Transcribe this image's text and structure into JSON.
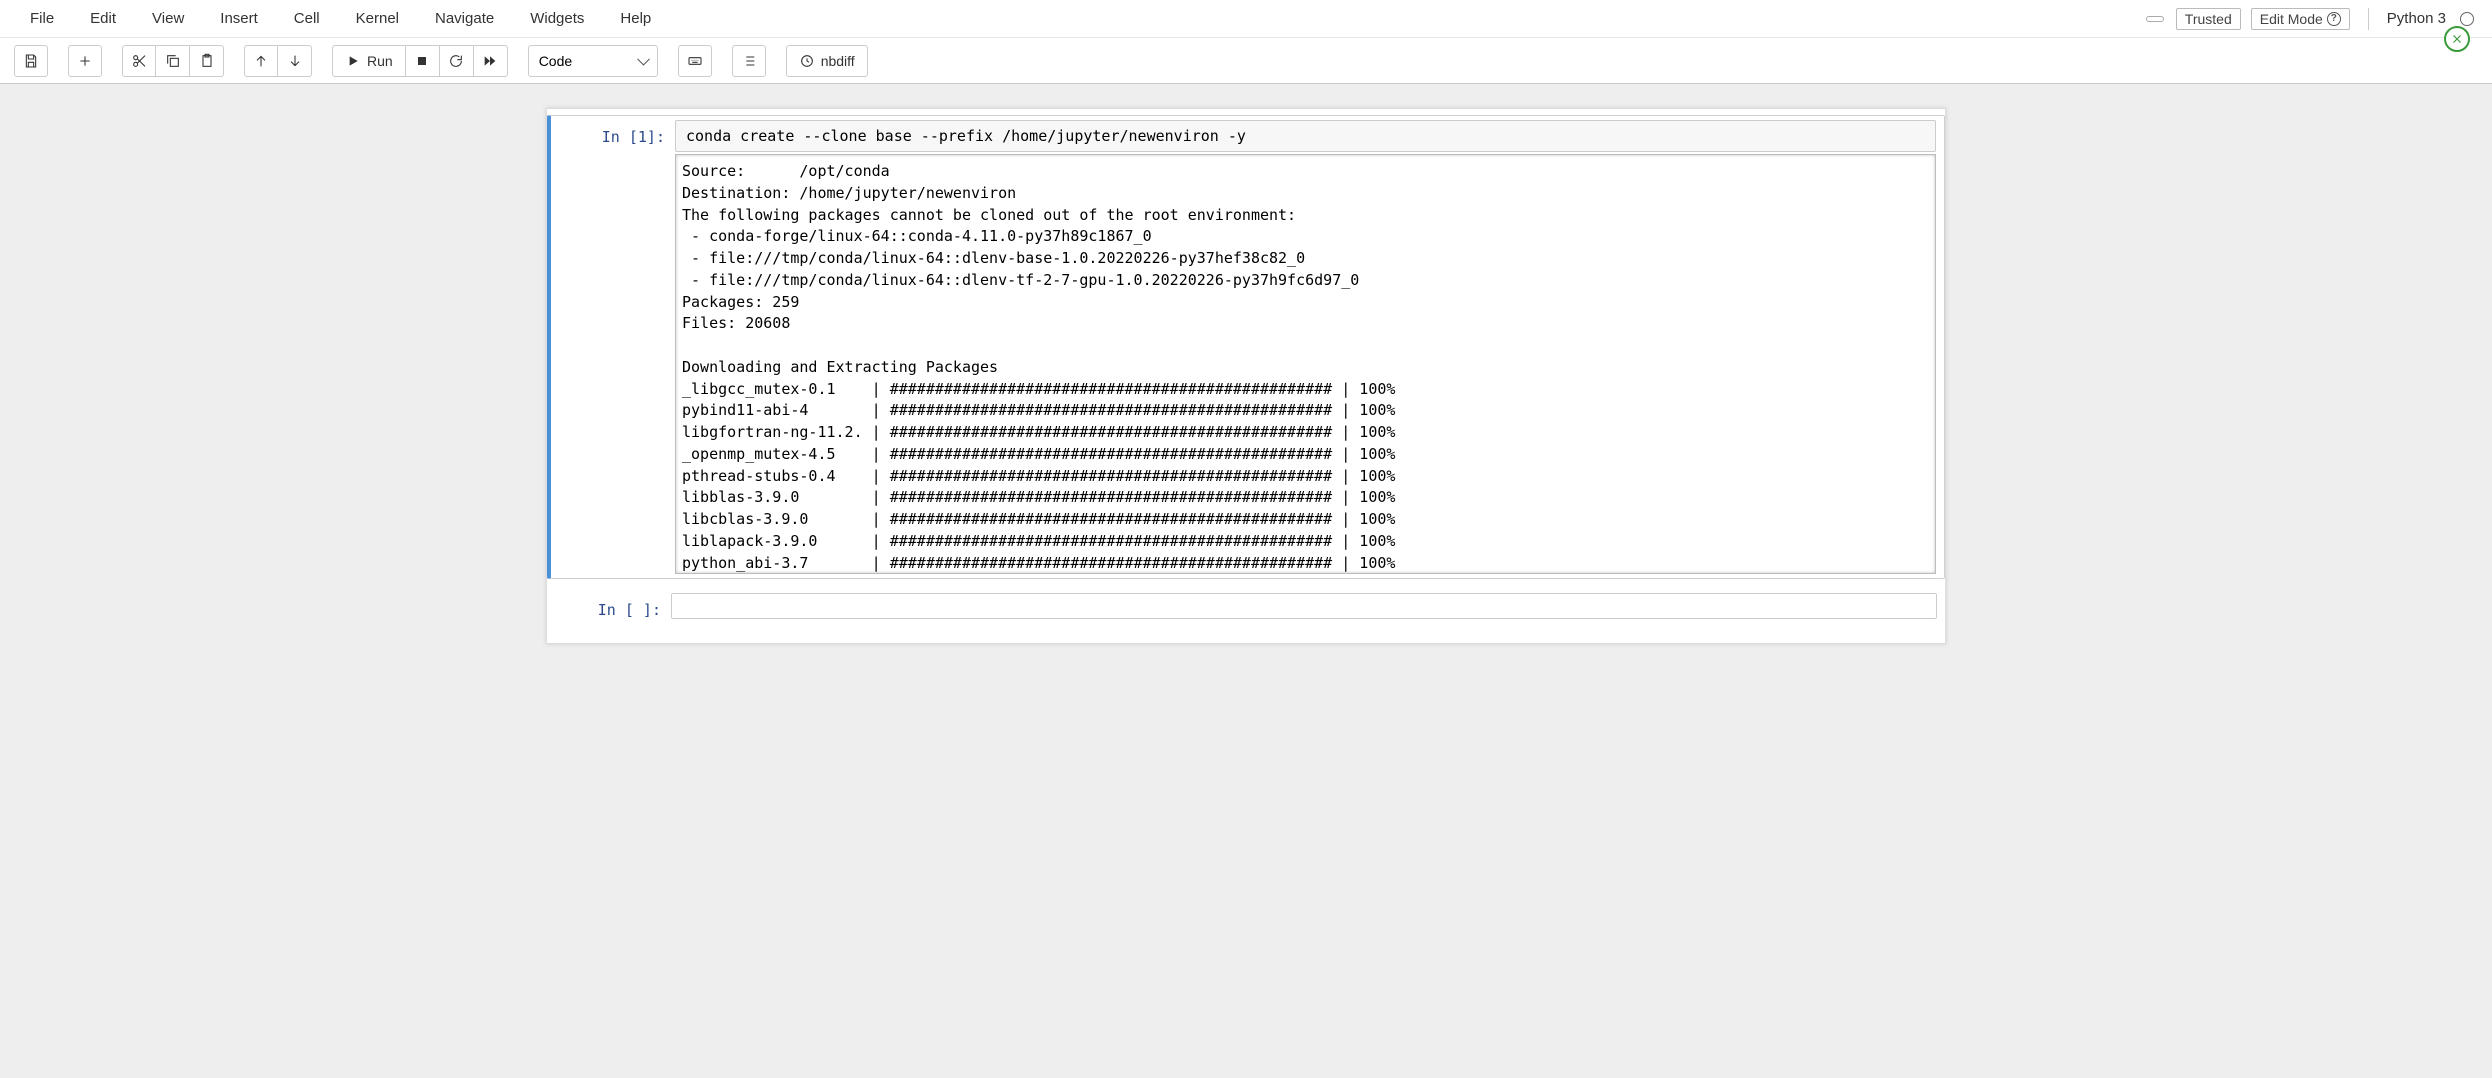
{
  "menus": [
    "File",
    "Edit",
    "View",
    "Insert",
    "Cell",
    "Kernel",
    "Navigate",
    "Widgets",
    "Help"
  ],
  "status": {
    "trusted": "Trusted",
    "edit_mode": "Edit Mode",
    "kernel": "Python 3"
  },
  "toolbar": {
    "run": "Run",
    "celltype": "Code",
    "nbdiff": "nbdiff"
  },
  "cells": [
    {
      "prompt": "In [1]:",
      "source": "conda create --clone base --prefix /home/jupyter/newenviron -y",
      "output": "Source:      /opt/conda\nDestination: /home/jupyter/newenviron\nThe following packages cannot be cloned out of the root environment:\n - conda-forge/linux-64::conda-4.11.0-py37h89c1867_0\n - file:///tmp/conda/linux-64::dlenv-base-1.0.20220226-py37hef38c82_0\n - file:///tmp/conda/linux-64::dlenv-tf-2-7-gpu-1.0.20220226-py37h9fc6d97_0\nPackages: 259\nFiles: 20608\n\nDownloading and Extracting Packages\n_libgcc_mutex-0.1    | ################################################# | 100%\npybind11-abi-4       | ################################################# | 100%\nlibgfortran-ng-11.2. | ################################################# | 100%\n_openmp_mutex-4.5    | ################################################# | 100%\npthread-stubs-0.4    | ################################################# | 100%\nlibblas-3.9.0        | ################################################# | 100%\nlibcblas-3.9.0       | ################################################# | 100%\nliblapack-3.9.0      | ################################################# | 100%\npython_abi-3.7       | ################################################# | 100%"
    },
    {
      "prompt": "In [ ]:",
      "source": "",
      "output": ""
    }
  ]
}
